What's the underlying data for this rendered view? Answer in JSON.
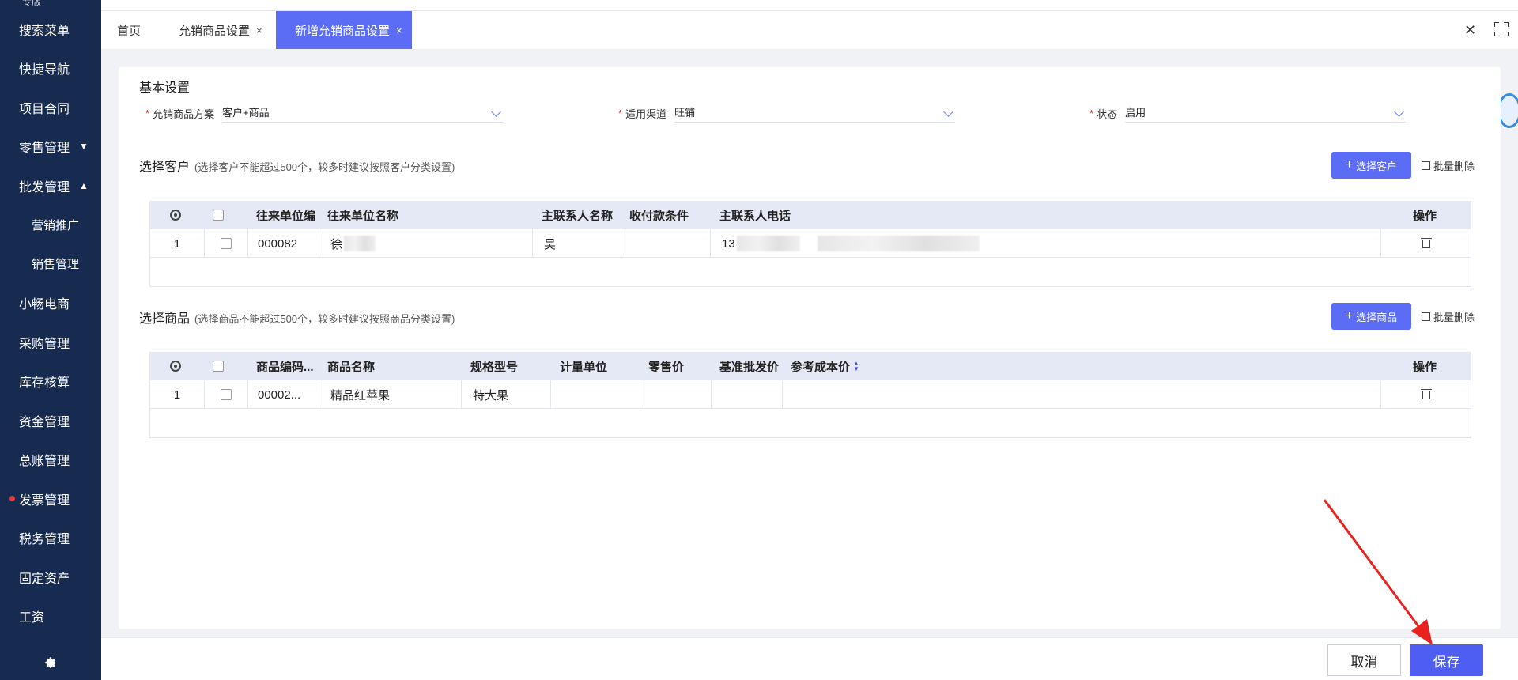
{
  "sidebar": {
    "top_label": "专版",
    "items": [
      {
        "label": "搜索菜单"
      },
      {
        "label": "快捷导航"
      },
      {
        "label": "项目合同"
      },
      {
        "label": "零售管理",
        "caret": "▼"
      },
      {
        "label": "批发管理",
        "caret": "▲"
      },
      {
        "label": "营销推广"
      },
      {
        "label": "销售管理"
      },
      {
        "label": "小畅电商"
      },
      {
        "label": "采购管理"
      },
      {
        "label": "库存核算"
      },
      {
        "label": "资金管理"
      },
      {
        "label": "总账管理"
      },
      {
        "label": "发票管理"
      },
      {
        "label": "税务管理"
      },
      {
        "label": "固定资产"
      },
      {
        "label": "工资"
      }
    ],
    "settings_icon": "gear-icon"
  },
  "tabs": [
    {
      "label": "首页"
    },
    {
      "label": "允销商品设置",
      "close": "×"
    },
    {
      "label": "新增允销商品设置",
      "close": "×"
    }
  ],
  "window": {
    "close": "✕"
  },
  "basic": {
    "title": "基本设置",
    "scheme": {
      "required": "*",
      "label": "允销商品方案",
      "value": "客户+商品"
    },
    "channel": {
      "required": "*",
      "label": "适用渠道",
      "value": "旺铺"
    },
    "status": {
      "required": "*",
      "label": "状态",
      "value": "启用"
    }
  },
  "customers": {
    "title": "选择客户",
    "note": "(选择客户不能超过500个，较多时建议按照客户分类设置)",
    "select_button": "选择客户",
    "batch_delete": "批量删除",
    "columns": [
      "往来单位编",
      "往来单位名称",
      "主联系人名称",
      "收付款条件",
      "主联系人电话",
      "操作"
    ],
    "rows": [
      {
        "index": "1",
        "code": "000082",
        "name": "徐",
        "contact": "吴",
        "terms": "",
        "phone": "13"
      }
    ]
  },
  "products": {
    "title": "选择商品",
    "note": "(选择商品不能超过500个，较多时建议按照商品分类设置)",
    "select_button": "选择商品",
    "batch_delete": "批量删除",
    "columns": [
      "商品编码...",
      "商品名称",
      "规格型号",
      "计量单位",
      "零售价",
      "基准批发价",
      "参考成本价",
      "操作"
    ],
    "rows": [
      {
        "index": "1",
        "code": "00002...",
        "name": "精品红苹果",
        "spec": "特大果",
        "unit": "",
        "retail": "",
        "wholesale": "",
        "cost": ""
      }
    ]
  },
  "footer": {
    "cancel": "取消",
    "save": "保存"
  },
  "colors": {
    "sidebar_bg": "#172a4f",
    "primary": "#5b6cf5",
    "save": "#4e5df2",
    "arrow": "#e8231f",
    "table_header": "#e5e9f5"
  }
}
